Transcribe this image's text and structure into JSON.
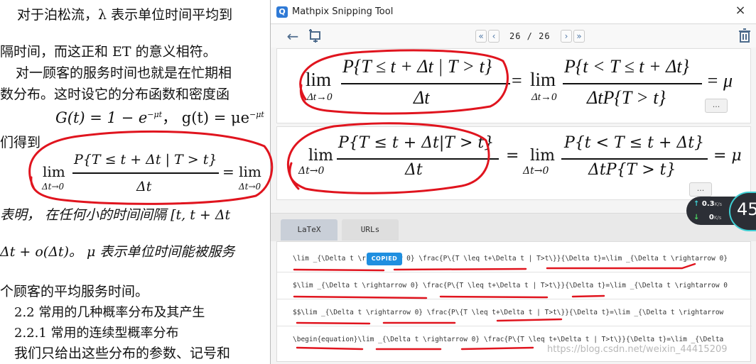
{
  "doc": {
    "line1": "对于泊松流，λ 表示单位时间平均到",
    "line2": "隔时间，而这正和 ET 的意义相符。",
    "line3": "对一顾客的服务时间也就是在忙期相",
    "line4": "数分布。这时设它的分布函数和密度函",
    "formula_G": "G(t) = 1 − e",
    "formula_G_exp": "−μt",
    "formula_g": "，  g(t) = μe",
    "formula_g_exp": "−μt",
    "line6": "们得到",
    "lim_main": "lim",
    "lim_sub": "Δt→0",
    "frac_num": "P{T ≤ t + Δt | T > t}",
    "frac_den": "Δt",
    "eq_tail": "= lim",
    "lim_sub2": "Δt→0",
    "line8": "表明， 在任何小的时间间隔 [t, t + Δt",
    "line9": "Δt + o(Δt)。 μ 表示单位时间能被服务",
    "line10": "个顾客的平均服务时间。",
    "line11": "2.2   常用的几种概率分布及其产生",
    "line12": "2.2.1   常用的连续型概率分布",
    "line13": "我们只给出这些分布的参数、记号和"
  },
  "window": {
    "title": "Mathpix Snipping Tool",
    "icon": "Q",
    "close": "×",
    "pager": "26 / 26",
    "dots": "...",
    "tabs": {
      "latex": "LaTeX",
      "urls": "URLs"
    },
    "copied": "COPIED"
  },
  "eq1": {
    "lim": "lim",
    "sub": "Δt→0",
    "num": "P{T ≤ t + Δt | T > t}",
    "den": "Δt",
    "eq": "=",
    "lim2": "lim",
    "sub2": "Δt→0",
    "num2": "P{t < T ≤ t + Δt}",
    "den2": "ΔtP{T > t}",
    "tail": "= μ"
  },
  "eq2": {
    "lim": "lim",
    "sub": "Δt→0",
    "num": "P{T ≤ t + Δt|T > t}",
    "den": "Δt",
    "eq": "=",
    "lim2": "lim",
    "sub2": "Δt→0",
    "num2": "P{t < T ≤ t + Δt}",
    "den2": "ΔtP{T > t}",
    "tail": "= μ"
  },
  "codes": [
    "\\lim _{\\Delta t \\rightarrow 0} \\frac{P\\{T \\leq t+\\Delta t | T>t\\}}{\\Delta t}=\\lim _{\\Delta t \\rightarrow 0}",
    "$\\lim _{\\Delta t \\rightarrow 0} \\frac{P\\{T \\leq t+\\Delta t | T>t\\}}{\\Delta t}=\\lim _{\\Delta t \\rightarrow 0",
    "$$\\lim _{\\Delta t \\rightarrow 0} \\frac{P\\{T \\leq t+\\Delta t | T>t\\}}{\\Delta t}=\\lim _{\\Delta t \\rightarrow",
    "\\begin{equation}\\lim _{\\Delta t \\rightarrow 0} \\frac{P\\{T \\leq t+\\Delta t | T>t\\}}{\\Delta t}=\\lim _{\\Delta"
  ],
  "watermark": "https://blog.csdn.net/weixin_44415209",
  "speed": {
    "up": "0.3",
    "up_unit": "K/s",
    "down": "0",
    "down_unit": "K/s",
    "value": "45"
  },
  "colors": {
    "accent": "#1f8fe0",
    "annotation": "#e0141e",
    "nav": "#4f77a6"
  }
}
